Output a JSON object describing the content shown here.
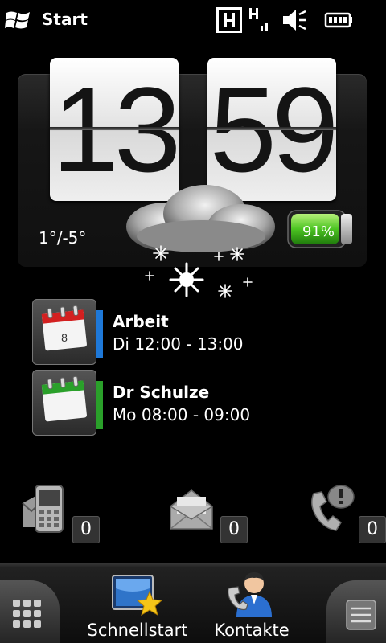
{
  "status_bar": {
    "title": "Start",
    "icons": [
      "windows-start-icon",
      "h-network-icon",
      "signal-icon",
      "mute-icon",
      "battery-icon"
    ]
  },
  "clock": {
    "hours": "13",
    "minutes": "59",
    "temperature": "1°/-5°",
    "weather": "snow-cloud-icon",
    "battery_percent": "91%"
  },
  "appointments": [
    {
      "title": "Arbeit",
      "time": "Di 12:00 - 13:00",
      "day": "8",
      "accent": "#1e78d8",
      "header": "#d32020"
    },
    {
      "title": "Dr Schulze",
      "time": "Mo 08:00 - 09:00",
      "day": "",
      "accent": "#2aa02a",
      "header": "#2aa02a"
    }
  ],
  "notifications": [
    {
      "name": "sms",
      "count": "0"
    },
    {
      "name": "email",
      "count": "0"
    },
    {
      "name": "missed-calls",
      "count": "0"
    }
  ],
  "bottom_bar": {
    "tabs": [
      {
        "label": "Schnellstart",
        "icon": "quick-launch-icon"
      },
      {
        "label": "Kontakte",
        "icon": "contacts-icon"
      }
    ]
  },
  "colors": {
    "battery_green": "#5fd12b",
    "cal_blue": "#1e78d8",
    "cal_green": "#2aa02a",
    "cal_red": "#d32020"
  }
}
